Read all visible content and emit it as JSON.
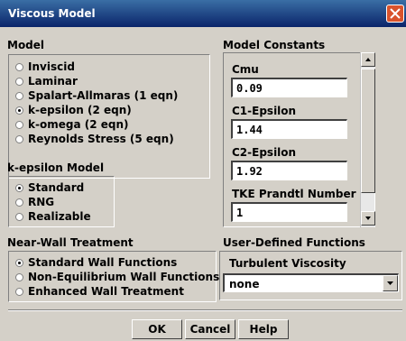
{
  "window": {
    "title": "Viscous Model"
  },
  "model": {
    "label": "Model",
    "options": [
      {
        "label": "Inviscid",
        "checked": false
      },
      {
        "label": "Laminar",
        "checked": false
      },
      {
        "label": "Spalart-Allmaras  (1 eqn)",
        "checked": false
      },
      {
        "label": "k-epsilon  (2 eqn)",
        "checked": true
      },
      {
        "label": "k-omega  (2 eqn)",
        "checked": false
      },
      {
        "label": "Reynolds Stress  (5 eqn)",
        "checked": false
      }
    ]
  },
  "kepsilon": {
    "label": "k-epsilon Model",
    "options": [
      {
        "label": "Standard",
        "checked": true
      },
      {
        "label": "RNG",
        "checked": false
      },
      {
        "label": "Realizable",
        "checked": false
      }
    ]
  },
  "nearwall": {
    "label": "Near-Wall Treatment",
    "options": [
      {
        "label": "Standard Wall Functions",
        "checked": true
      },
      {
        "label": "Non-Equilibrium Wall Functions",
        "checked": false
      },
      {
        "label": "Enhanced Wall Treatment",
        "checked": false
      }
    ]
  },
  "constants": {
    "label": "Model Constants",
    "items": [
      {
        "label": "Cmu",
        "value": "0.09"
      },
      {
        "label": "C1-Epsilon",
        "value": "1.44"
      },
      {
        "label": "C2-Epsilon",
        "value": "1.92"
      },
      {
        "label": "TKE Prandtl Number",
        "value": "1"
      }
    ]
  },
  "udf": {
    "label": "User-Defined Functions",
    "field_label": "Turbulent Viscosity",
    "selected": "none"
  },
  "buttons": {
    "ok": "OK",
    "cancel": "Cancel",
    "help": "Help"
  }
}
